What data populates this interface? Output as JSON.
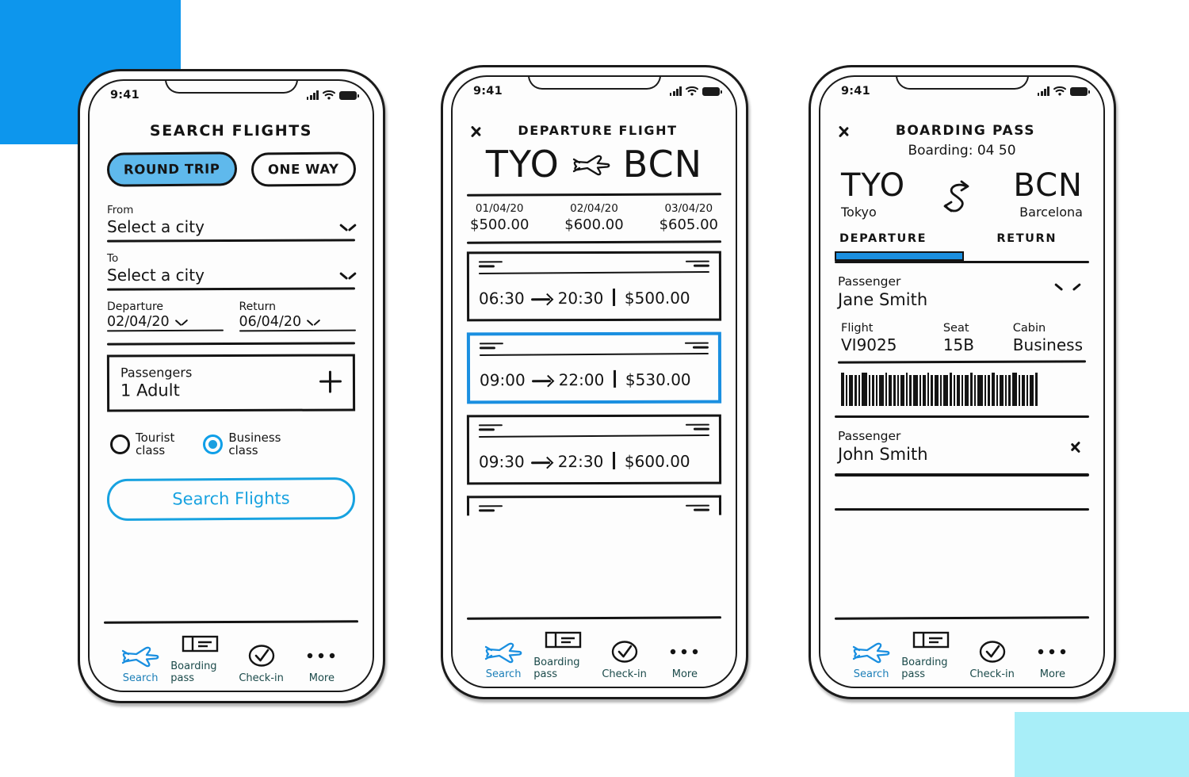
{
  "palette": {
    "brand_blue": "#0d96ed",
    "pill_fill": "#5fb9ec",
    "accent_cyan": "#17a2e0",
    "selected_border": "#1a8fe0",
    "bg_cyan": "#a8eef8",
    "ink": "#141414"
  },
  "status_bar": {
    "time": "9:41",
    "icons": [
      "signal-bars-icon",
      "wifi-icon",
      "battery-icon"
    ]
  },
  "tab_bar": {
    "items": [
      {
        "label": "Search",
        "icon": "plane-icon",
        "active": true
      },
      {
        "label": "Boarding pass",
        "icon": "ticket-icon",
        "active": false
      },
      {
        "label": "Check-in",
        "icon": "check-circle-icon",
        "active": false
      },
      {
        "label": "More",
        "icon": "ellipsis-icon",
        "active": false
      }
    ]
  },
  "screen_search": {
    "title": "SEARCH FLIGHTS",
    "trip_types": [
      {
        "label": "ROUND TRIP",
        "selected": true
      },
      {
        "label": "ONE WAY",
        "selected": false
      }
    ],
    "from": {
      "label": "From",
      "value": "Select a city",
      "placeholder": "Select a city"
    },
    "to": {
      "label": "To",
      "value": "Select a city",
      "placeholder": "Select a city"
    },
    "departure": {
      "label": "Departure",
      "value": "02/04/20"
    },
    "return": {
      "label": "Return",
      "value": "06/04/20"
    },
    "passengers": {
      "label": "Passengers",
      "value": "1 Adult",
      "add_icon": "plus-icon"
    },
    "classes": [
      {
        "label_line1": "Tourist",
        "label_line2": "class",
        "selected": false
      },
      {
        "label_line1": "Business",
        "label_line2": "class",
        "selected": true
      }
    ],
    "cta": "Search Flights"
  },
  "screen_departure": {
    "back_icon": "chevron-left-icon",
    "title": "DEPARTURE FLIGHT",
    "route": {
      "origin": "TYO",
      "destination": "BCN",
      "icon": "plane-icon"
    },
    "date_prices": [
      {
        "date": "01/04/20",
        "price": "$500.00"
      },
      {
        "date": "02/04/20",
        "price": "$600.00"
      },
      {
        "date": "03/04/20",
        "price": "$605.00"
      }
    ],
    "flights": [
      {
        "depart": "06:30",
        "arrive": "20:30",
        "price": "$500.00",
        "selected": false
      },
      {
        "depart": "09:00",
        "arrive": "22:00",
        "price": "$530.00",
        "selected": true
      },
      {
        "depart": "09:30",
        "arrive": "22:30",
        "price": "$600.00",
        "selected": false
      }
    ]
  },
  "screen_boarding": {
    "back_icon": "chevron-left-icon",
    "title": "BOARDING PASS",
    "boarding_time": "Boarding: 04 50",
    "route": {
      "origin_code": "TYO",
      "origin_city": "Tokyo",
      "destination_code": "BCN",
      "destination_city": "Barcelona",
      "icon": "swap-arrows-icon"
    },
    "tabs": [
      {
        "label": "DEPARTURE",
        "active": true
      },
      {
        "label": "RETURN",
        "active": false
      }
    ],
    "primary_passenger": {
      "label": "Passenger",
      "name": "Jane Smith",
      "expand_icon": "chevron-down-icon",
      "flight": {
        "label": "Flight",
        "value": "VI9025"
      },
      "seat": {
        "label": "Seat",
        "value": "15B"
      },
      "cabin": {
        "label": "Cabin",
        "value": "Business"
      },
      "barcode": "barcode-icon"
    },
    "secondary_passenger": {
      "label": "Passenger",
      "name": "John Smith",
      "expand_icon": "chevron-right-icon"
    }
  }
}
